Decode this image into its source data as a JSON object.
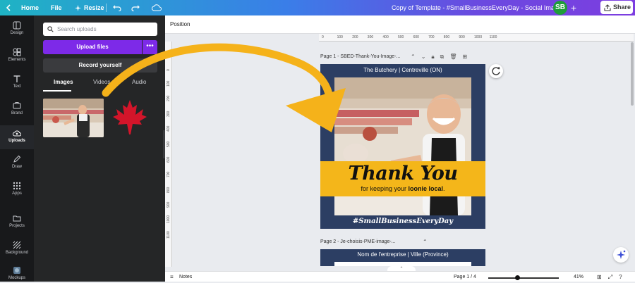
{
  "topbar": {
    "home": "Home",
    "file": "File",
    "resize": "Resize",
    "doc_title": "Copy of Template - #SmallBusinessEveryDay - Social Images",
    "avatar_initials": "SB",
    "share": "Share"
  },
  "rail": {
    "items": [
      "Design",
      "Elements",
      "Text",
      "Brand",
      "Uploads",
      "Draw",
      "Apps",
      "Projects",
      "Background",
      "Mockups"
    ]
  },
  "panel": {
    "search_placeholder": "Search uploads",
    "upload_files": "Upload files",
    "more": "•••",
    "record": "Record yourself",
    "tabs": [
      "Images",
      "Videos",
      "Audio"
    ]
  },
  "toolbar": {
    "position": "Position"
  },
  "ruler_h": [
    "0",
    "100",
    "200",
    "300",
    "400",
    "500",
    "600",
    "700",
    "800",
    "900",
    "1000",
    "1100"
  ],
  "ruler_v": [
    "0",
    "100",
    "200",
    "300",
    "400",
    "500",
    "600",
    "700",
    "800",
    "900",
    "1000",
    "1100"
  ],
  "page1": {
    "label": "Page 1 - SBED-Thank-You-Image-...",
    "header": "The Butchery | Centreville (ON)",
    "thank_you": "Thank You",
    "sub_pre": "for keeping your ",
    "sub_bold": "loonie local",
    "sub_post": ".",
    "hashtag": "#SmallBusinessEveryDay"
  },
  "page2": {
    "label": "Page 2 - Je-choisis-PME-image-...",
    "header": "Nom de l'entreprise | Ville (Province)"
  },
  "footer": {
    "notes": "Notes",
    "page_indicator": "Page 1 / 4",
    "zoom": "41%",
    "zoom_fraction": 0.41
  },
  "colors": {
    "accent_purple": "#7d2ae8",
    "page_navy": "#2c3e63",
    "banner_yellow": "#f4b61a",
    "arrow_orange": "#f5b21a",
    "leaf_red": "#d3152a"
  }
}
